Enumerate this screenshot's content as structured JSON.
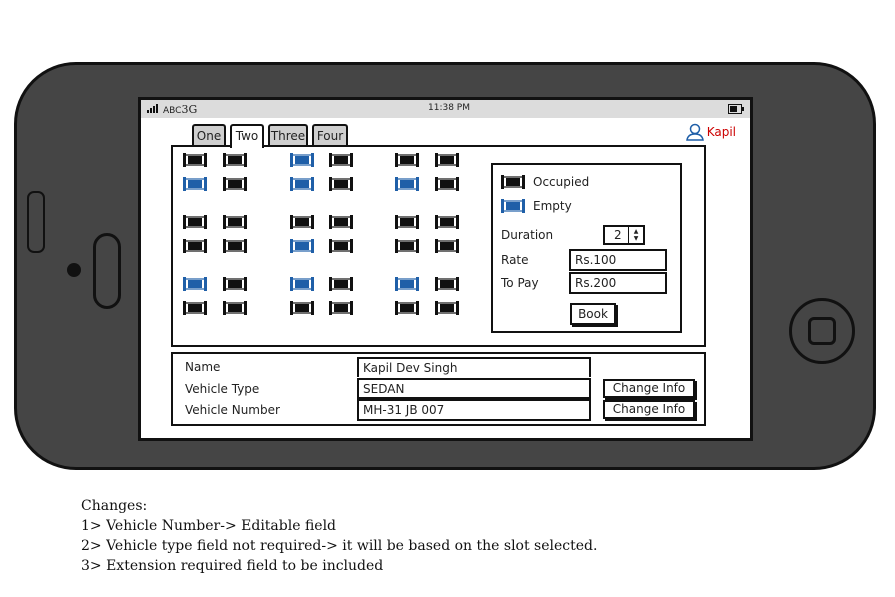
{
  "status": {
    "carrier": "ABC",
    "network": "3G",
    "time": "11:38 PM"
  },
  "tabs": [
    "One",
    "Two",
    "Three",
    "Four"
  ],
  "active_tab": "Two",
  "user": {
    "name": "Kapil"
  },
  "parking": {
    "slots": [
      "O",
      "O",
      "E",
      "O",
      "O",
      "O",
      "E",
      "O",
      "E",
      "O",
      "E",
      "O",
      "O",
      "O",
      "O",
      "O",
      "O",
      "O",
      "O",
      "O",
      "E",
      "O",
      "O",
      "O",
      "E",
      "O",
      "E",
      "O",
      "E",
      "O",
      "O",
      "O",
      "O",
      "O",
      "O",
      "O"
    ],
    "legend": {
      "occupied": "Occupied",
      "empty": "Empty"
    },
    "duration": {
      "label": "Duration",
      "value": "2"
    },
    "rate": {
      "label": "Rate",
      "value": "Rs.100"
    },
    "to_pay": {
      "label": "To Pay",
      "value": "Rs.200"
    },
    "book_label": "Book"
  },
  "vehicle_info": {
    "name_label": "Name",
    "name_value": "Kapil Dev Singh",
    "type_label": "Vehicle Type",
    "type_value": "SEDAN",
    "number_label": "Vehicle Number",
    "number_value": "MH-31 JB 007",
    "change_type_label": "Change Info",
    "change_number_label": "Change Info"
  },
  "notes": [
    "Changes:",
    "1> Vehicle Number-> Editable field",
    "2> Vehicle type field not required-> it will be based on the slot selected.",
    "3> Extension required field to be included"
  ],
  "colors": {
    "occupied": "#111111",
    "empty": "#1f5fa8",
    "user": "#cc0000"
  }
}
